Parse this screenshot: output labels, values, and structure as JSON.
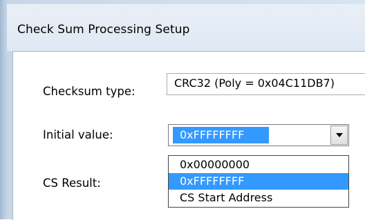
{
  "window": {
    "title": "Check Sum Processing Setup"
  },
  "form": {
    "checksum_type_label": "Checksum type:",
    "checksum_type_value": "CRC32 (Poly = 0x04C11DB7)",
    "initial_value_label": "Initial value:",
    "initial_value_selected": "0xFFFFFFFF",
    "cs_result_label": "CS Result:"
  },
  "dropdown": {
    "options": [
      "0x00000000",
      "0xFFFFFFFF",
      "CS Start Address"
    ],
    "highlighted": "0xFFFFFFFF"
  },
  "icons": {
    "combo_button": "chevron-down-icon"
  },
  "colors": {
    "selection": "#3399ff",
    "title_bar": "#dfe8f3"
  }
}
